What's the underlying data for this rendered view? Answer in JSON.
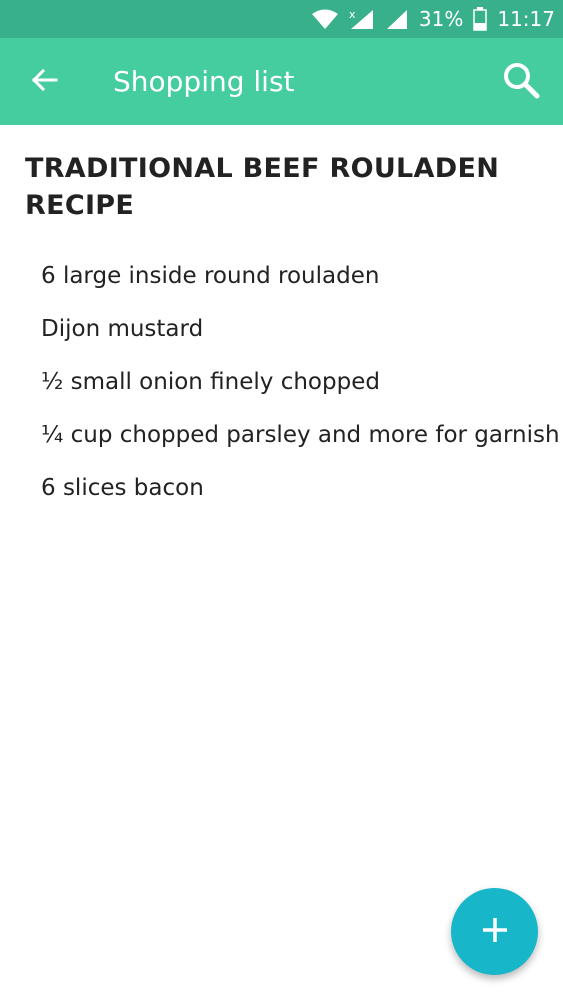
{
  "status_bar": {
    "battery_percent": "31%",
    "time": "11:17",
    "icons": [
      "wifi-icon",
      "signal-no-data-icon",
      "signal-icon",
      "battery-icon"
    ]
  },
  "app_bar": {
    "title": "Shopping list",
    "back_icon": "arrow-back-icon",
    "search_icon": "search-icon",
    "color": "#45cc9f"
  },
  "recipe": {
    "title": "TRADITIONAL BEEF ROULADEN RECIPE",
    "items": [
      "6 large inside round rouladen",
      "Dijon mustard",
      "½ small onion finely chopped",
      "¼ cup chopped parsley and more for garnish",
      "6 slices bacon"
    ]
  },
  "fab": {
    "icon": "plus-icon",
    "color": "#17b6c9"
  }
}
